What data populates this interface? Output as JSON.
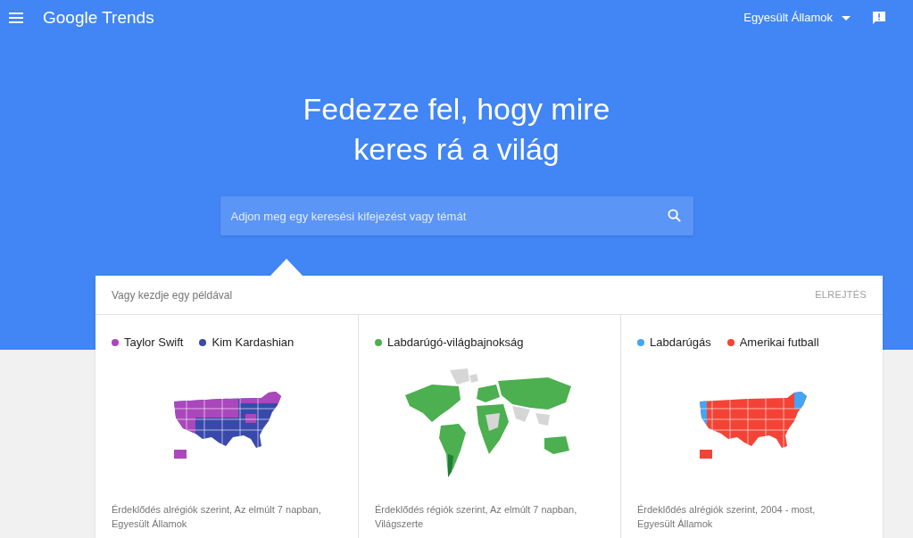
{
  "header": {
    "logo": "Google Trends",
    "region": "Egyesült Államok"
  },
  "hero": {
    "title_lines": [
      "Fedezze fel, hogy mire",
      "keres rá a világ"
    ]
  },
  "search": {
    "placeholder": "Adjon meg egy keresési kifejezést vagy témát"
  },
  "examples": {
    "heading": "Vagy kezdje egy példával",
    "dismiss": "ELREJTÉS",
    "cards": [
      {
        "kind": "us",
        "legend": [
          {
            "label": "Taylor Swift",
            "color": "#ab47bc"
          },
          {
            "label": "Kim Kardashian",
            "color": "#3949ab"
          }
        ],
        "caption": "Érdeklődés alrégiók szerint, Az elmúlt 7 napban, Egyesült Államok"
      },
      {
        "kind": "world",
        "legend": [
          {
            "label": "Labdarúgó-világbajnokság",
            "color": "#4caf50"
          }
        ],
        "caption": "Érdeklődés régiók szerint, Az elmúlt 7 napban, Világszerte"
      },
      {
        "kind": "us",
        "legend": [
          {
            "label": "Labdarúgás",
            "color": "#42a5f5"
          },
          {
            "label": "Amerikai futball",
            "color": "#f44336"
          }
        ],
        "caption": "Érdeklődés alrégiók szerint, 2004 - most, Egyesült Államok"
      }
    ]
  }
}
